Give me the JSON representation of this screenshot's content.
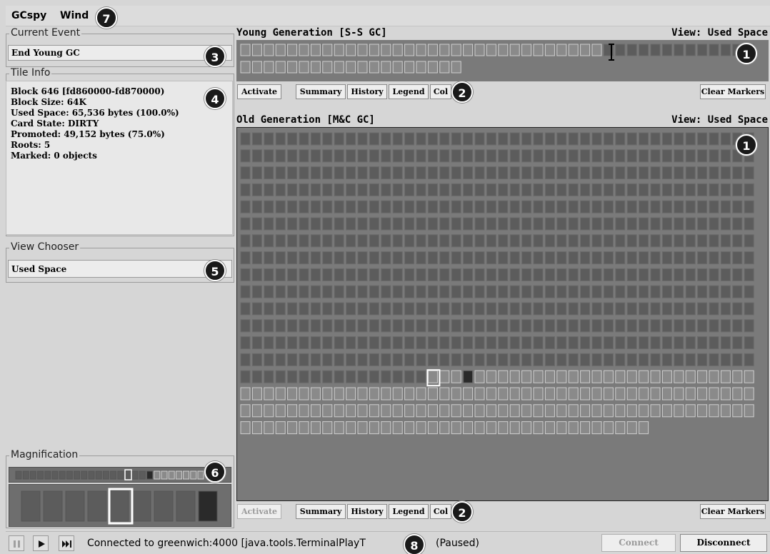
{
  "menu": {
    "items": [
      "GCspy",
      "Wind"
    ]
  },
  "badges": {
    "b1": "1",
    "b2": "2",
    "b3": "3",
    "b4": "4",
    "b5": "5",
    "b6": "6",
    "b7": "7",
    "b8": "8"
  },
  "left": {
    "current_event": {
      "title": "Current Event",
      "value": "End Young GC"
    },
    "tile_info": {
      "title": "Tile Info",
      "lines": [
        "Block 646   [fd860000-fd870000)",
        "Block Size: 64K",
        "Used Space: 65,536 bytes  (100.0%)",
        "Card State: DIRTY",
        "Promoted: 49,152 bytes  (75.0%)",
        "Roots: 5",
        "Marked: 0 objects"
      ]
    },
    "view_chooser": {
      "title": "View Chooser",
      "value": "Used Space"
    },
    "magnification": {
      "title": "Magnification"
    }
  },
  "young": {
    "title": "Young Generation  [S-S GC]",
    "view": "View: Used Space",
    "buttons": {
      "activate": "Activate",
      "summary": "Summary",
      "history": "History",
      "legend": "Legend",
      "col": "Col",
      "clear": "Clear Markers"
    }
  },
  "old": {
    "title": "Old Generation  [M&C GC]",
    "view": "View: Used Space",
    "buttons": {
      "activate": "Activate",
      "summary": "Summary",
      "history": "History",
      "legend": "Legend",
      "col": "Col",
      "clear": "Clear Markers"
    }
  },
  "status": {
    "text": "Connected to greenwich:4000 [java.tools.TerminalPlayT",
    "paused": "(Paused)",
    "connect": "Connect",
    "disconnect": "Disconnect"
  },
  "colors": {
    "tile_used": "#5c5c5c",
    "tile_free": "#8a8a8a",
    "tile_dark": "#2a2a2a",
    "selected": "#ffffff"
  }
}
